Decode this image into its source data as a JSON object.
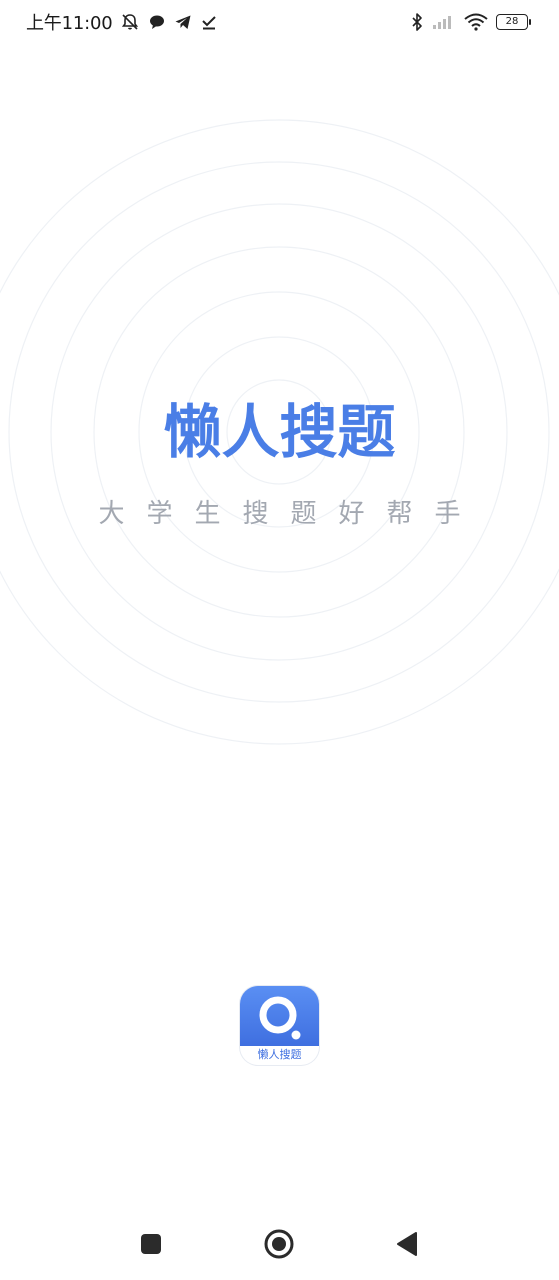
{
  "status_bar": {
    "time": "上午11:00",
    "icons": [
      "alarm-off-icon",
      "chat-bubble-icon",
      "telegram-icon",
      "download-done-icon",
      "bluetooth-icon",
      "signal-icon",
      "wifi-icon"
    ],
    "battery_level": "28"
  },
  "splash": {
    "title": "懒人搜题",
    "slogan": "大学生搜题好帮手",
    "accent_color": "#4a7ee6",
    "slogan_color": "#a3a8b1"
  },
  "app_icon": {
    "label": "懒人搜题",
    "icon": "magnifier-q-icon"
  },
  "nav_bar": {
    "buttons": [
      "recents-button",
      "home-button",
      "back-button"
    ]
  }
}
